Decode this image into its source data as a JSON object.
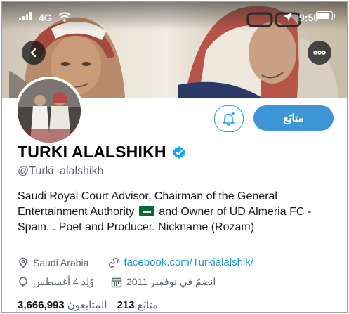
{
  "status_bar": {
    "carrier": "4G",
    "time": "9:50"
  },
  "banner": {
    "back_icon": "chevron-left-icon",
    "more_icon": "more-horizontal-icon"
  },
  "profile": {
    "display_name": "TURKI ALALSHIKH",
    "verified_icon": "verified-badge-icon",
    "handle": "@Turki_alalshikh",
    "bio_part1": "Saudi Royal Court Advisor, Chairman of the General Entertainment Authority",
    "bio_flag_icon": "saudi-flag-icon",
    "bio_part2": "and Owner of UD Almeria FC - Spain... Poet and Producer. Nickname (Rozam)",
    "location": "Saudi Arabia",
    "website": "facebook.com/Turkialalshik/",
    "joined": "انضمّ في نوفمبر 2011",
    "born": "وُلِد 4 أغسطس",
    "following_count": "213",
    "following_label": "متابَع",
    "followers_count": "3,666,993",
    "followers_label": "المتابعون"
  },
  "actions": {
    "follow_label": "متابَع",
    "notify_icon": "bell-plus-icon"
  },
  "colors": {
    "accent": "#1da1f2",
    "follow_button": "#3e95d5",
    "muted_text": "#5b6670"
  }
}
